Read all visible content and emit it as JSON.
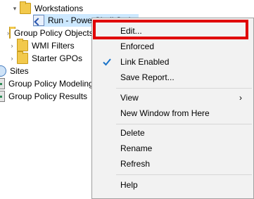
{
  "tree": {
    "workstations": {
      "label": "Workstations",
      "arrow": "▾"
    },
    "run_script": {
      "label": "Run - PowerShell Script"
    },
    "group_policy_objects": {
      "label": "Group Policy Objects",
      "arrow": "›"
    },
    "wmi_filters": {
      "label": "WMI Filters",
      "arrow": "›"
    },
    "starter_gpos": {
      "label": "Starter GPOs",
      "arrow": "›"
    },
    "sites": {
      "label": "Sites"
    },
    "group_policy_modeling": {
      "label": "Group Policy Modeling"
    },
    "group_policy_results": {
      "label": "Group Policy Results"
    }
  },
  "menu": {
    "edit": "Edit...",
    "enforced": "Enforced",
    "link_enabled": "Link Enabled",
    "link_enabled_checked": true,
    "save_report": "Save Report...",
    "view": "View",
    "view_arrow": "›",
    "new_window": "New Window from Here",
    "delete": "Delete",
    "rename": "Rename",
    "refresh": "Refresh",
    "help": "Help"
  },
  "colors": {
    "highlight": "#e00000",
    "selection": "#cce8ff",
    "checkmark": "#1a73c8"
  }
}
